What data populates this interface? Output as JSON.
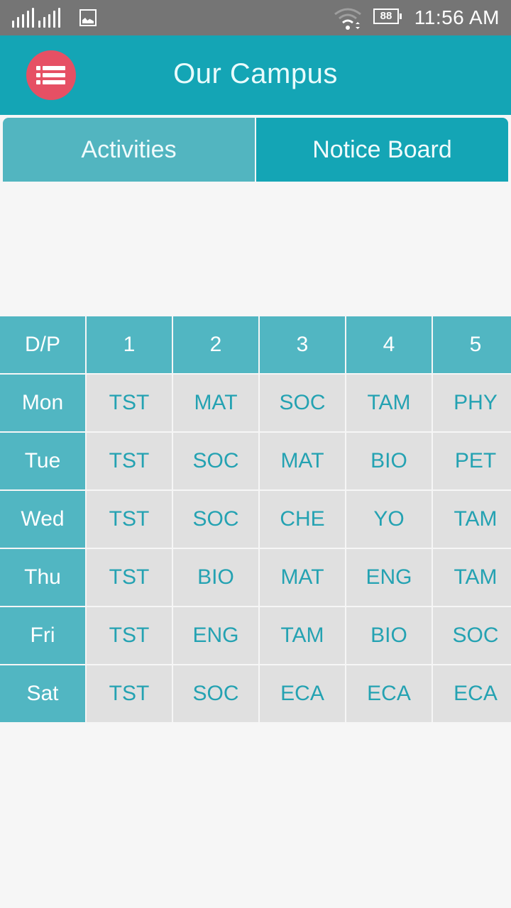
{
  "status_bar": {
    "battery_level": "88",
    "time": "11:56 AM",
    "icons": [
      "signal-sim1-icon",
      "signal-sim2-icon",
      "gallery-notification-icon",
      "wifi-icon",
      "battery-icon"
    ]
  },
  "app_bar": {
    "title": "Our Campus",
    "menu_icon": "list-menu-icon",
    "menu_button_color": "#e65064",
    "background_color": "#14a5b5"
  },
  "tabs": [
    {
      "label": "Activities"
    },
    {
      "label": "Notice Board"
    }
  ],
  "timetable": {
    "corner_label": "D/P",
    "periods": [
      "1",
      "2",
      "3",
      "4",
      "5"
    ],
    "rows": [
      {
        "day": "Mon",
        "subjects": [
          "TST",
          "MAT",
          "SOC",
          "TAM",
          "PHY"
        ]
      },
      {
        "day": "Tue",
        "subjects": [
          "TST",
          "SOC",
          "MAT",
          "BIO",
          "PET"
        ]
      },
      {
        "day": "Wed",
        "subjects": [
          "TST",
          "SOC",
          "CHE",
          "YO",
          "TAM"
        ]
      },
      {
        "day": "Thu",
        "subjects": [
          "TST",
          "BIO",
          "MAT",
          "ENG",
          "TAM"
        ]
      },
      {
        "day": "Fri",
        "subjects": [
          "TST",
          "ENG",
          "TAM",
          "BIO",
          "SOC"
        ]
      },
      {
        "day": "Sat",
        "subjects": [
          "TST",
          "SOC",
          "ECA",
          "ECA",
          "ECA"
        ]
      }
    ]
  }
}
